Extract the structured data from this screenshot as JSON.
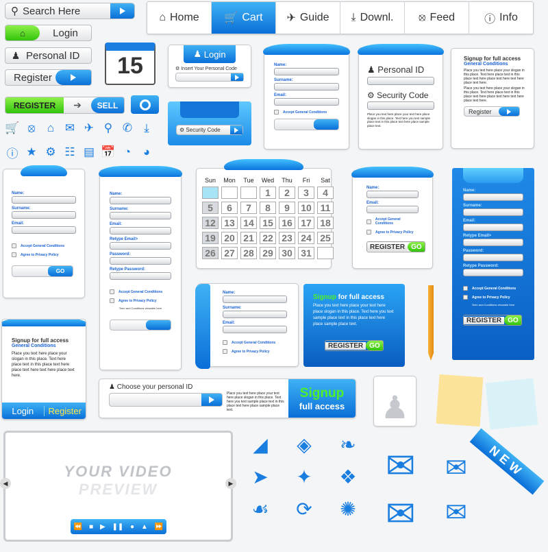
{
  "search": {
    "placeholder": "Search Here"
  },
  "buttons": {
    "login": "Login",
    "personal_id": "Personal ID",
    "register": "Register",
    "register_caps": "REGISTER",
    "sell": "SELL"
  },
  "calendar_icon": {
    "day": "15"
  },
  "nav": {
    "tabs": [
      {
        "label": "Home",
        "icon": "home-icon"
      },
      {
        "label": "Cart",
        "icon": "cart-icon",
        "active": true
      },
      {
        "label": "Guide",
        "icon": "plane-icon"
      },
      {
        "label": "Downl.",
        "icon": "download-icon"
      },
      {
        "label": "Feed",
        "icon": "rss-icon"
      },
      {
        "label": "Info",
        "icon": "info-icon"
      }
    ]
  },
  "icons_row1": [
    "cart-icon",
    "rss-icon",
    "home-icon",
    "mail-icon",
    "plane-icon",
    "search-icon",
    "phone-icon",
    "download-icon"
  ],
  "icons_row2": [
    "info-icon",
    "star-icon",
    "gears-icon",
    "sitemap-icon",
    "trash-icon",
    "calendar-icon",
    "pie-chart-icon",
    "pie-chart-icon"
  ],
  "login_box": {
    "title": "Login",
    "code_label": "Insert Your Personal Code"
  },
  "security_box": {
    "label": "Security Code"
  },
  "form": {
    "name": "Name:",
    "surname": "Surname:",
    "email": "Email:",
    "retype_email": "Retype Email>",
    "password": "Password:",
    "retype_password": "Retype Password:",
    "accept": "Accept General Conditions",
    "privacy": "Agree to Privacy Policy",
    "terms": "Term and Conditions viewable here",
    "go": "GO"
  },
  "pid_box": {
    "personal_id": "Personal ID",
    "security_code": "Security Code",
    "text": "Place you text here place your text here place slogan in this place. Text here you text sample place text in this place text here place sample place text."
  },
  "signup": {
    "title": "Signup for full access",
    "subtitle": "General Conditions",
    "text1": "Place you text here place your slogan in this place. Text here place text in this place text here place text here text here place text here.",
    "text2": "Place you text here place your slogan in this place. Text here place text in this place text here place text here text here place text here.",
    "register": "Register",
    "login": "Login",
    "signup_word": "Signup",
    "for_full_access": "for full access",
    "full_access": "full access",
    "blue_text": "Place you text here place your text here place slogan in this place. Text here you text sample place text in this place text here place sample place text."
  },
  "calendar": {
    "days": [
      "Sun",
      "Mon",
      "Tue",
      "Wed",
      "Thu",
      "Fri",
      "Sat"
    ],
    "cells": [
      "",
      "",
      "",
      "1",
      "2",
      "3",
      "4",
      "5",
      "6",
      "7",
      "8",
      "9",
      "10",
      "11",
      "12",
      "13",
      "14",
      "15",
      "16",
      "17",
      "18",
      "19",
      "20",
      "21",
      "22",
      "23",
      "24",
      "25",
      "26",
      "27",
      "28",
      "29",
      "30",
      "31",
      ""
    ]
  },
  "choose_id": {
    "label": "Choose your personal ID",
    "text": "Place you text here place your text here place slogan in this place. Text here you text sample place text in this place text here place sample place text."
  },
  "video": {
    "line1": "YOUR VIDEO",
    "line2": "PREVIEW"
  },
  "ribbon": {
    "text": "NEW"
  },
  "colors": {
    "accent": "#0a6fd8",
    "light_blue": "#3fb2f5",
    "green": "#32c40a"
  }
}
